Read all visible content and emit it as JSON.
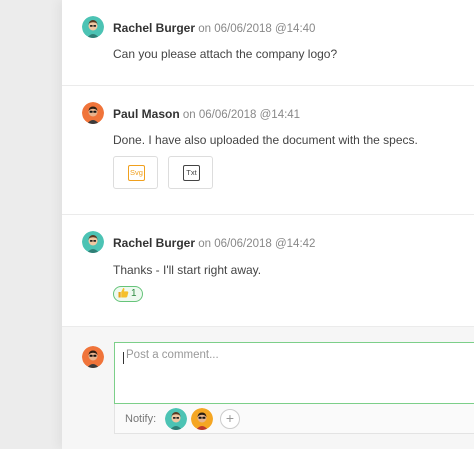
{
  "comments": [
    {
      "author": "Rachel Burger",
      "meta": "on 06/06/2018 @14:40",
      "text": "Can you please attach the company logo?"
    },
    {
      "author": "Paul Mason",
      "meta": "on 06/06/2018 @14:41",
      "text": "Done. I have also uploaded the document with the specs.",
      "attachments": [
        {
          "label": "Svg",
          "color": "#f0a01e"
        },
        {
          "label": "Txt",
          "color": "#444444"
        }
      ]
    },
    {
      "author": "Rachel Burger",
      "meta": "on 06/06/2018 @14:42",
      "text": "Thanks - I'll start right away.",
      "reaction": {
        "icon": "thumbs-up-icon",
        "count": "1"
      }
    }
  ],
  "composer": {
    "placeholder": "Post a comment...",
    "notify_label": "Notify:",
    "add_icon": "plus-icon",
    "add_label": "+"
  },
  "colors": {
    "accent_green": "#66c47a",
    "avatar_teal": "#4cc3b4",
    "avatar_orange": "#f0743a"
  }
}
